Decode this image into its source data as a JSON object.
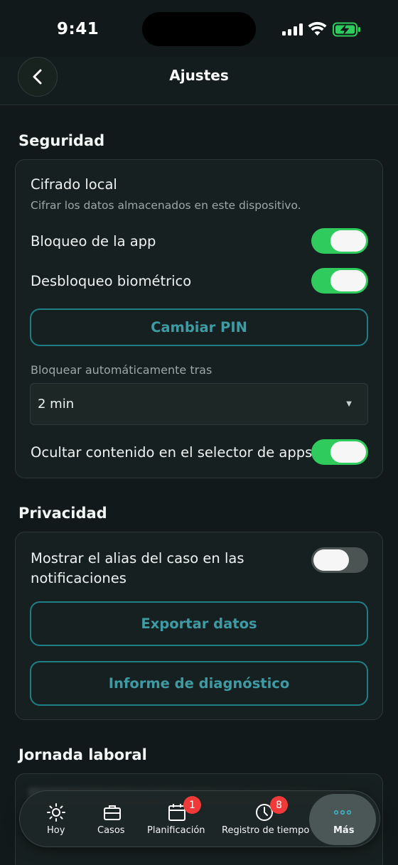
{
  "status": {
    "time": "9:41"
  },
  "header": {
    "title": "Ajustes"
  },
  "security": {
    "title": "Seguridad",
    "local_encryption": "Cifrado local",
    "local_encryption_desc": "Cifrar los datos almacenados en este dispositivo.",
    "app_lock": "Bloqueo de la app",
    "biometric": "Desbloqueo biométrico",
    "change_pin": "Cambiar PIN",
    "autolock_label": "Bloquear automáticamente tras",
    "autolock_value": "2 min",
    "hide_switcher": "Ocultar contenido en el selector de apps"
  },
  "privacy": {
    "title": "Privacidad",
    "show_alias": "Mostrar el alias del caso en las notificaciones",
    "export": "Exportar datos",
    "diagnostics": "Informe de diagnóstico"
  },
  "work": {
    "title": "Jornada laboral"
  },
  "tabs": [
    {
      "label": "Hoy",
      "icon": "sun-icon"
    },
    {
      "label": "Casos",
      "icon": "briefcase-icon"
    },
    {
      "label": "Planificación",
      "icon": "calendar-icon",
      "badge": "1"
    },
    {
      "label": "Registro de tiempo",
      "icon": "clock-icon",
      "badge": "8"
    },
    {
      "label": "Más",
      "icon": "more-icon"
    }
  ],
  "colors": {
    "accent": "#2fcb5c",
    "button": "#3e9ba3",
    "badge": "#f03a3a"
  }
}
